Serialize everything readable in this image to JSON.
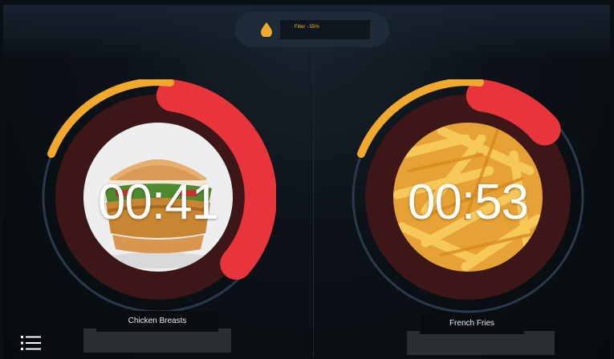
{
  "filter": {
    "text": "Filter - 55%",
    "level": 0.55,
    "icon": "oil-drop-icon"
  },
  "timers": [
    {
      "item": "Chicken Breasts",
      "time": "00:41",
      "remaining_fraction": 0.38,
      "outer_progress": 0.27
    },
    {
      "item": "French Fries",
      "time": "00:53",
      "remaining_fraction": 0.18,
      "outer_progress": 0.27
    }
  ],
  "menu": {
    "icon": "list-menu-icon"
  },
  "colors": {
    "accent_yellow": "#f0a92c",
    "alarm_red": "#e8353b",
    "ring_dark": "#3d1618",
    "ring_outline": "#2a3a4c"
  }
}
